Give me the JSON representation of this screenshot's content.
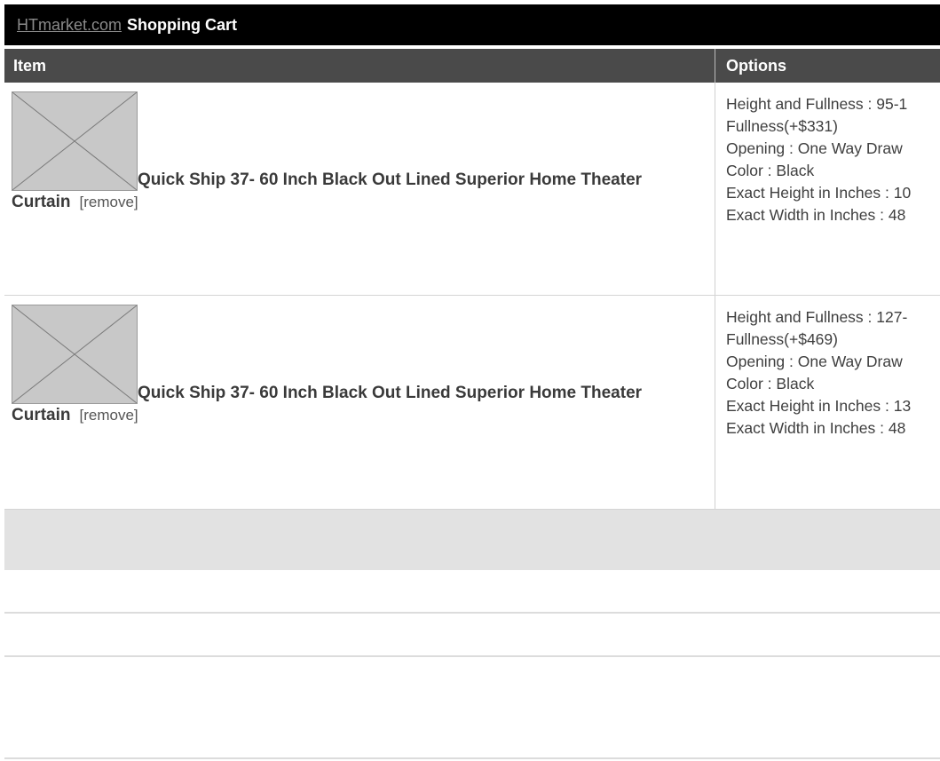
{
  "header": {
    "site_link": "HTmarket.com",
    "title": "Shopping Cart"
  },
  "columns": {
    "item": "Item",
    "options": "Options"
  },
  "items": [
    {
      "name_line1": "Quick Ship 37- 60 Inch Black Out Lined Superior Home Theater",
      "name_line2": "Curtain",
      "remove_label": "[remove]",
      "options": [
        "Height and Fullness : 95-1",
        "Fullness(+$331)",
        "Opening : One Way Draw",
        "Color : Black",
        "Exact Height in Inches : 10",
        "Exact Width in Inches : 48"
      ]
    },
    {
      "name_line1": "Quick Ship 37- 60 Inch Black Out Lined Superior Home Theater",
      "name_line2": "Curtain",
      "remove_label": "[remove]",
      "options": [
        "Height and Fullness : 127-",
        "Fullness(+$469)",
        "Opening : One Way Draw",
        "Color : Black",
        "Exact Height in Inches : 13",
        "Exact Width in Inches : 48"
      ]
    }
  ]
}
